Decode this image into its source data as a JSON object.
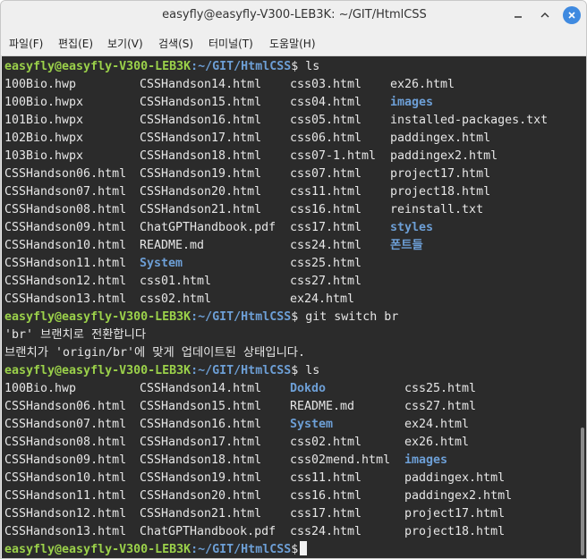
{
  "window": {
    "title": "easyfly@easyfly-V300-LEB3K: ~/GIT/HtmlCSS"
  },
  "menu": [
    "파일(F)",
    "편집(E)",
    "보기(V)",
    "검색(S)",
    "터미널(T)",
    "도움말(H)"
  ],
  "terminal": {
    "prompt_user": "easyfly@easyfly-V300-LEB3K",
    "prompt_path": ":~/GIT/HtmlCSS",
    "prompt_symbol": "$",
    "cmd1": " ls",
    "ls1": [
      [
        "100Bio.hwp",
        "CSSHandson14.html",
        "css03.html",
        "ex26.html"
      ],
      [
        "100Bio.hwpx",
        "CSSHandson15.html",
        "css04.html",
        "images"
      ],
      [
        "101Bio.hwpx",
        "CSSHandson16.html",
        "css05.html",
        "installed-packages.txt"
      ],
      [
        "102Bio.hwpx",
        "CSSHandson17.html",
        "css06.html",
        "paddingex.html"
      ],
      [
        "103Bio.hwpx",
        "CSSHandson18.html",
        "css07-1.html",
        "paddingex2.html"
      ],
      [
        "CSSHandson06.html",
        "CSSHandson19.html",
        "css07.html",
        "project17.html"
      ],
      [
        "CSSHandson07.html",
        "CSSHandson20.html",
        "css11.html",
        "project18.html"
      ],
      [
        "CSSHandson08.html",
        "CSSHandson21.html",
        "css16.html",
        "reinstall.txt"
      ],
      [
        "CSSHandson09.html",
        "ChatGPTHandbook.pdf",
        "css17.html",
        "styles"
      ],
      [
        "CSSHandson10.html",
        "README.md",
        "css24.html",
        "폰트들"
      ],
      [
        "CSSHandson11.html",
        "System",
        "css25.html",
        ""
      ],
      [
        "CSSHandson12.html",
        "css01.html",
        "css27.html",
        ""
      ],
      [
        "CSSHandson13.html",
        "css02.html",
        "ex24.html",
        ""
      ]
    ],
    "cmd2": " git switch br",
    "out1": "'br' 브랜치로 전환합니다",
    "out2": "브랜치가 'origin/br'에 맞게 업데이트된 상태입니다.",
    "cmd3": " ls",
    "ls2": [
      [
        "100Bio.hwp",
        "CSSHandson14.html",
        "Dokdo",
        "css25.html"
      ],
      [
        "CSSHandson06.html",
        "CSSHandson15.html",
        "README.md",
        "css27.html"
      ],
      [
        "CSSHandson07.html",
        "CSSHandson16.html",
        "System",
        "ex24.html"
      ],
      [
        "CSSHandson08.html",
        "CSSHandson17.html",
        "css02.html",
        "ex26.html"
      ],
      [
        "CSSHandson09.html",
        "CSSHandson18.html",
        "css02mend.html",
        "images"
      ],
      [
        "CSSHandson10.html",
        "CSSHandson19.html",
        "css11.html",
        "paddingex.html"
      ],
      [
        "CSSHandson11.html",
        "CSSHandson20.html",
        "css16.html",
        "paddingex2.html"
      ],
      [
        "CSSHandson12.html",
        "CSSHandson21.html",
        "css17.html",
        "project17.html"
      ],
      [
        "CSSHandson13.html",
        "ChatGPTHandbook.pdf",
        "css24.html",
        "project18.html"
      ]
    ],
    "dirs": [
      "images",
      "styles",
      "폰트들",
      "System",
      "Dokdo"
    ]
  },
  "colors": {
    "background": "#2b2b2b",
    "text": "#e6e6e6",
    "prompt_user": "#9bd14a",
    "prompt_path": "#6d9fd6",
    "directory": "#6d9fd6",
    "close_button": "#3f8ae0"
  },
  "icons": [
    "minimize-icon",
    "maximize-icon",
    "close-icon"
  ]
}
